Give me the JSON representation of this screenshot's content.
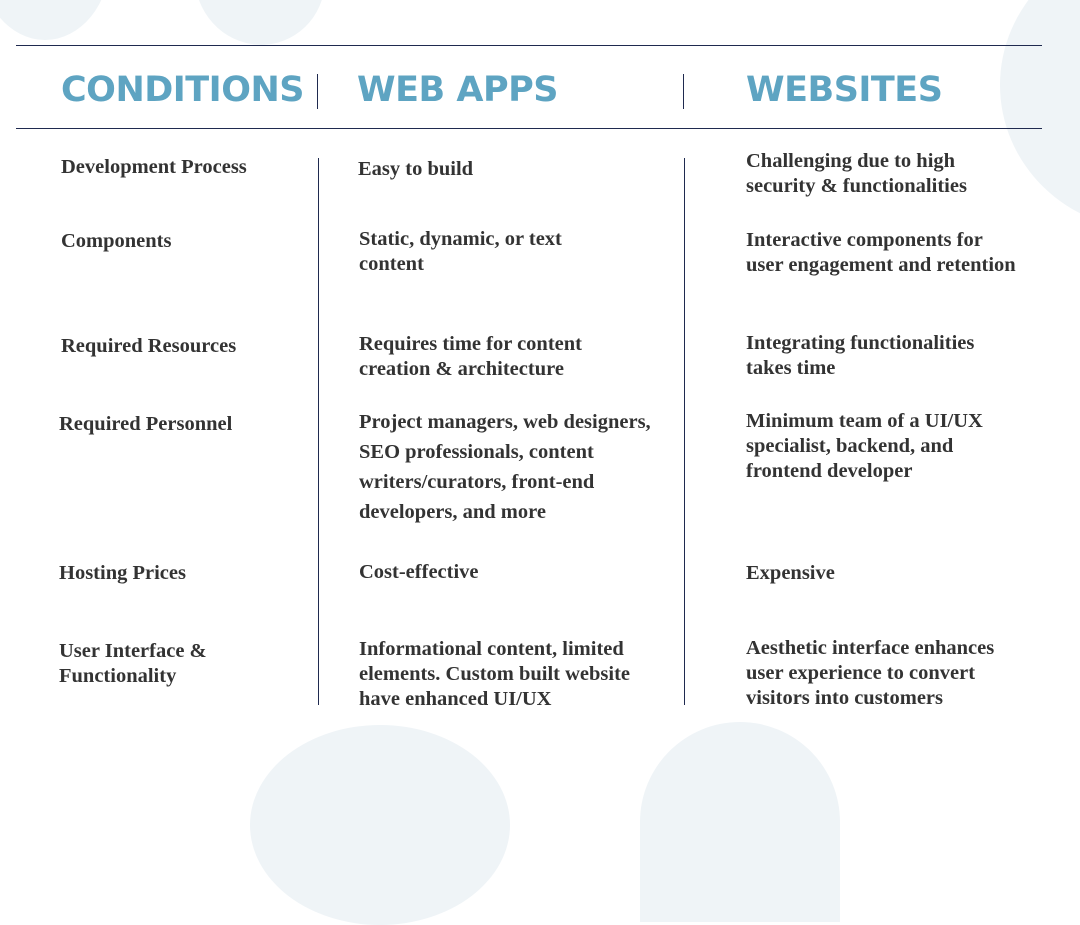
{
  "colors": {
    "heading": "#5ea4c2",
    "body_text": "#333333",
    "rules": "#1f2a4f",
    "background_shapes": "#eff4f7"
  },
  "headers": {
    "conditions": "CONDITIONS",
    "web_apps": "WEB APPS",
    "websites": "WEBSITES"
  },
  "rows": [
    {
      "condition": "Development Process",
      "web_apps": "Easy to build",
      "websites": "Challenging due to high security & functionalities"
    },
    {
      "condition": "Components",
      "web_apps": "Static, dynamic, or text content",
      "websites": "Interactive components for user engagement and retention"
    },
    {
      "condition": "Required Resources",
      "web_apps": "Requires time for content creation & architecture",
      "websites": "Integrating functionalities takes time"
    },
    {
      "condition": "Required Personnel",
      "web_apps": "Project managers, web designers, SEO professionals, content writers/curators, front-end developers, and more",
      "websites": "Minimum team of a UI/UX specialist, backend, and frontend developer"
    },
    {
      "condition": "Hosting Prices",
      "web_apps": "Cost-effective",
      "websites": "Expensive"
    },
    {
      "condition": "User Interface & Functionality",
      "web_apps": "Informational content, limited elements. Custom built website have enhanced UI/UX",
      "websites": "Aesthetic interface enhances user experience to convert visitors into customers"
    }
  ]
}
